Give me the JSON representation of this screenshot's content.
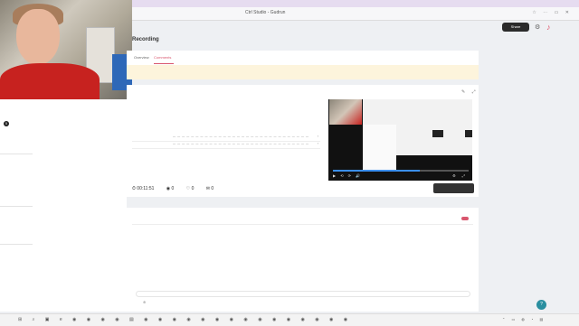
{
  "browser": {
    "url": "Ctrl Studio - Gudrun"
  },
  "sidebar": {
    "items": [
      "",
      "",
      "",
      "",
      "",
      "",
      "",
      "",
      "",
      "",
      "",
      "",
      "",
      "",
      "",
      "",
      "",
      ""
    ],
    "badge": "5"
  },
  "header": {
    "title": "Recording",
    "share_label": "Share"
  },
  "tabs": [
    {
      "label": "Overview"
    },
    {
      "label": "Comments"
    }
  ],
  "notice": {
    "text": ""
  },
  "main": {
    "title": "",
    "subtitle": "",
    "fields": [
      {
        "label": ""
      },
      {
        "label": ""
      }
    ],
    "stats": {
      "duration": "00:11:51",
      "views": "0",
      "likes": "0",
      "comments": "0"
    },
    "join_label": ""
  },
  "video": {
    "progress": 0.64
  },
  "comments": {
    "tabs": [
      {
        "label": ""
      },
      {
        "label": ""
      }
    ],
    "toggle_label": "",
    "input_placeholder": "",
    "post_label": ""
  }
}
